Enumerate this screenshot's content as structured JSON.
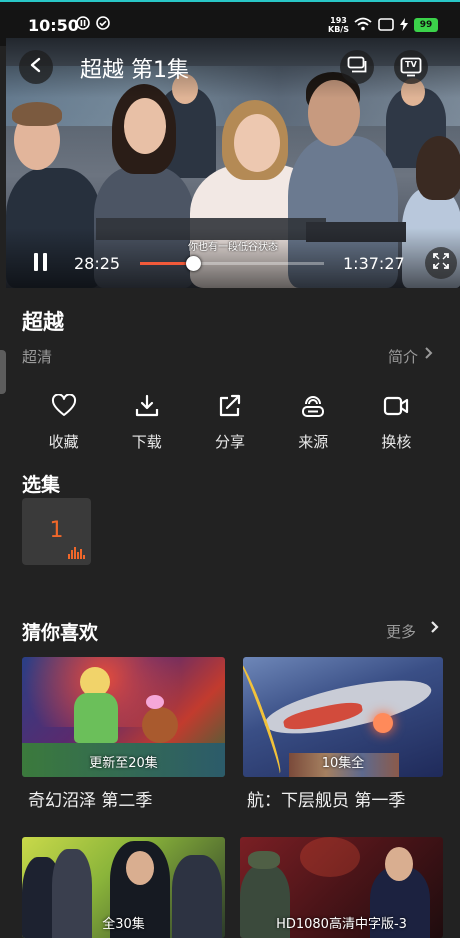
{
  "status_bar": {
    "time": "10:50",
    "net_speed_value": "193",
    "net_speed_unit": "KB/S",
    "battery": "99"
  },
  "player": {
    "title": "超越 第1集",
    "subtitle": "你也有一段低谷状态",
    "current_time": "28:25",
    "total_time": "1:37:27",
    "progress": 0.29,
    "cast_icon": "cast-screen-icon",
    "tv_icon": "tv-icon",
    "tv_label": "TV"
  },
  "info": {
    "title": "超越",
    "quality": "超清",
    "intro_label": "简介"
  },
  "actions": [
    {
      "icon": "heart-icon",
      "label": "收藏"
    },
    {
      "icon": "download-icon",
      "label": "下载"
    },
    {
      "icon": "share-icon",
      "label": "分享"
    },
    {
      "icon": "source-icon",
      "label": "来源"
    },
    {
      "icon": "switch-core-icon",
      "label": "换核"
    }
  ],
  "episodes": {
    "heading": "选集",
    "items": [
      {
        "number": "1",
        "playing": true
      }
    ]
  },
  "recommend": {
    "heading": "猜你喜欢",
    "more_label": "更多",
    "items": [
      {
        "badge": "更新至20集",
        "title": "奇幻沼泽 第二季"
      },
      {
        "badge": "10集全",
        "title": "航：下层舰员 第一季"
      },
      {
        "badge": "全30集",
        "title": ""
      },
      {
        "badge": "HD1080高清中字版-3",
        "title": ""
      }
    ]
  },
  "colors": {
    "accent": "#f0672a",
    "seek_fill": "#f15a3a",
    "background": "#222222",
    "muted_text": "#9a9a9a"
  }
}
